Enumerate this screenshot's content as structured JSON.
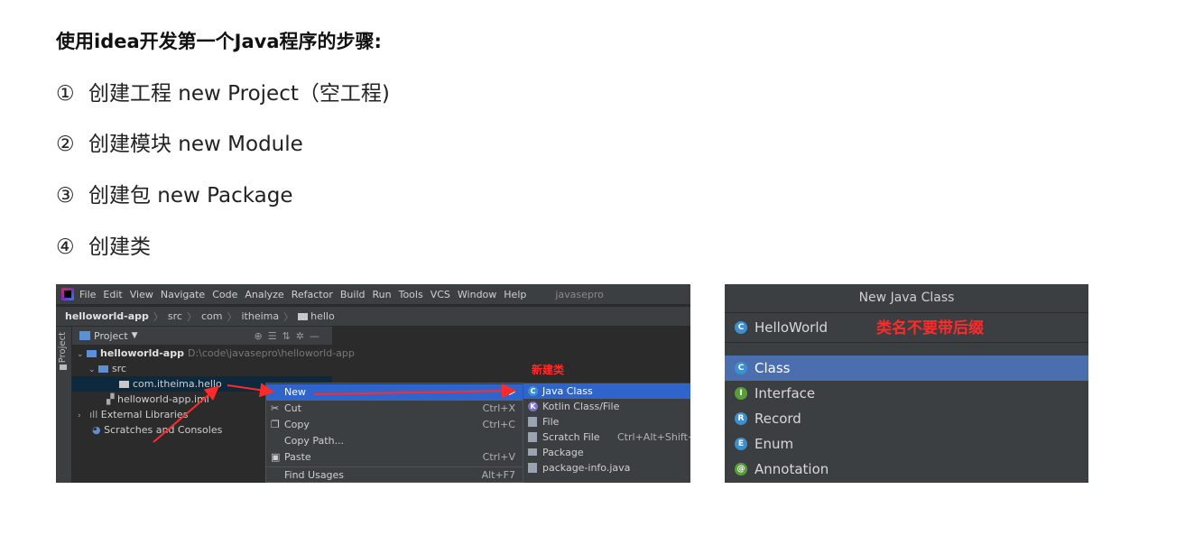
{
  "heading": "使用idea开发第一个Java程序的步骤:",
  "steps": [
    {
      "num": "①",
      "text": "创建工程 new Project（空工程)"
    },
    {
      "num": "②",
      "text": "创建模块 new Module"
    },
    {
      "num": "③",
      "text": "创建包 new Package"
    },
    {
      "num": "④",
      "text": "创建类"
    }
  ],
  "ide": {
    "menu": [
      "File",
      "Edit",
      "View",
      "Navigate",
      "Code",
      "Analyze",
      "Refactor",
      "Build",
      "Run",
      "Tools",
      "VCS",
      "Window",
      "Help"
    ],
    "project_name": "javasepro",
    "breadcrumb": [
      "helloworld-app",
      "src",
      "com",
      "itheima",
      "hello"
    ],
    "side_tab": "Project",
    "panel_title": "Project",
    "tree": {
      "root": "helloworld-app",
      "root_path": "D:\\code\\javasepro\\helloworld-app",
      "src": "src",
      "package": "com.itheima.hello",
      "iml": "helloworld-app.iml",
      "ext_libs": "External Libraries",
      "scratches": "Scratches and Consoles"
    },
    "context_menu": [
      {
        "label": "New",
        "shortcut": ""
      },
      {
        "label": "Cut",
        "shortcut": "Ctrl+X"
      },
      {
        "label": "Copy",
        "shortcut": "Ctrl+C"
      },
      {
        "label": "Copy Path...",
        "shortcut": ""
      },
      {
        "label": "Paste",
        "shortcut": "Ctrl+V"
      },
      {
        "label": "Find Usages",
        "shortcut": "Alt+F7"
      }
    ],
    "submenu": [
      {
        "label": "Java Class",
        "shortcut": ""
      },
      {
        "label": "Kotlin Class/File",
        "shortcut": ""
      },
      {
        "label": "File",
        "shortcut": ""
      },
      {
        "label": "Scratch File",
        "shortcut": "Ctrl+Alt+Shift+Ins"
      },
      {
        "label": "Package",
        "shortcut": ""
      },
      {
        "label": "package-info.java",
        "shortcut": ""
      }
    ],
    "annotation": "新建类",
    "colors": {
      "highlight": "#2f65ca",
      "annotation": "#ff2a2a",
      "background": "#2b2b2b"
    }
  },
  "dialog": {
    "title": "New Java Class",
    "name_value": "HelloWorld",
    "hint": "类名不要带后缀",
    "options": [
      {
        "label": "Class",
        "icon": "C",
        "color": "#3d8fd1"
      },
      {
        "label": "Interface",
        "icon": "I",
        "color": "#5a9e3a"
      },
      {
        "label": "Record",
        "icon": "R",
        "color": "#3d8fd1"
      },
      {
        "label": "Enum",
        "icon": "E",
        "color": "#3d8fd1"
      },
      {
        "label": "Annotation",
        "icon": "@",
        "color": "#5a9e3a"
      }
    ],
    "colors": {
      "selected": "#4b6eaf"
    }
  }
}
